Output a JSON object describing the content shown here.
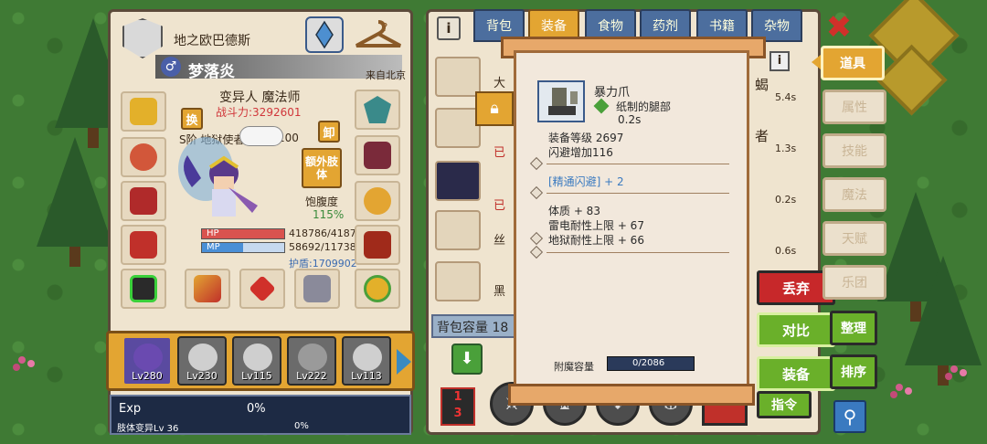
{
  "character": {
    "location": "地之欧巴德斯",
    "name": "梦落炎",
    "origin": "来自北京",
    "class_line": "变异人 魔法师",
    "power_label": "战斗力:3292601",
    "rank_line": "S阶 地狱使者",
    "rank_number": "100",
    "swap_label": "换",
    "unequip_label": "卸",
    "extra_body_label": "额外肢体",
    "satiety_label": "饱腹度",
    "satiety_value": "115%",
    "hp_label": "HP",
    "hp_value": "418786/4187",
    "mp_label": "MP",
    "mp_value": "58692/11738",
    "shield_label": "护盾:1709902",
    "hp_fraction": 1.0,
    "mp_fraction": 0.5
  },
  "team": [
    {
      "level": "Lv280"
    },
    {
      "level": "Lv230"
    },
    {
      "level": "Lv115"
    },
    {
      "level": "Lv222"
    },
    {
      "level": "Lv113"
    }
  ],
  "exp": {
    "label": "Exp",
    "percent": "0%",
    "sub_label": "肢体变异Lv 36",
    "sub_percent": "0%"
  },
  "tabs": [
    "背包",
    "装备",
    "食物",
    "药剂",
    "书籍",
    "杂物"
  ],
  "bag": {
    "capacity_label": "背包容量 18",
    "rows": [
      {
        "text_left": "大",
        "text_right": "蝎",
        "time": "5.4s"
      },
      {
        "text_left": "已",
        "text_right": "者",
        "time": "1.3s"
      },
      {
        "text_left": "已",
        "text_right": "",
        "time": "0.2s"
      },
      {
        "text_left": "丝",
        "text_right": "",
        "time": "0.6s"
      },
      {
        "text_left": "黑",
        "text_right": "",
        "time": ""
      }
    ]
  },
  "tooltip": {
    "item_name": "暴力爪",
    "part": "纸制的腿部",
    "time": "0.2s",
    "equip_level": "装备等级 2697",
    "dodge_bonus": "闪避增加116",
    "refine": "[精通闪避] + 2",
    "stat_1": "体质 + 83",
    "stat_2": "雷电耐性上限 + 67",
    "stat_3": "地狱耐性上限 + 66",
    "enchant_label": "附魔容量",
    "enchant_value": "0/2086"
  },
  "actions": {
    "discard": "丢弃",
    "compare": "对比",
    "equip": "装备",
    "command": "指令",
    "arrange": "整理",
    "sort": "排序"
  },
  "side_menu": [
    "道具",
    "属性",
    "技能",
    "魔法",
    "天赋",
    "乐团"
  ],
  "colors": {
    "accent_orange": "#e3a532",
    "hp_red": "#d9534f",
    "mp_blue": "#4a8fd6",
    "discard_red": "#c7282a",
    "action_green": "#6ab02a"
  }
}
